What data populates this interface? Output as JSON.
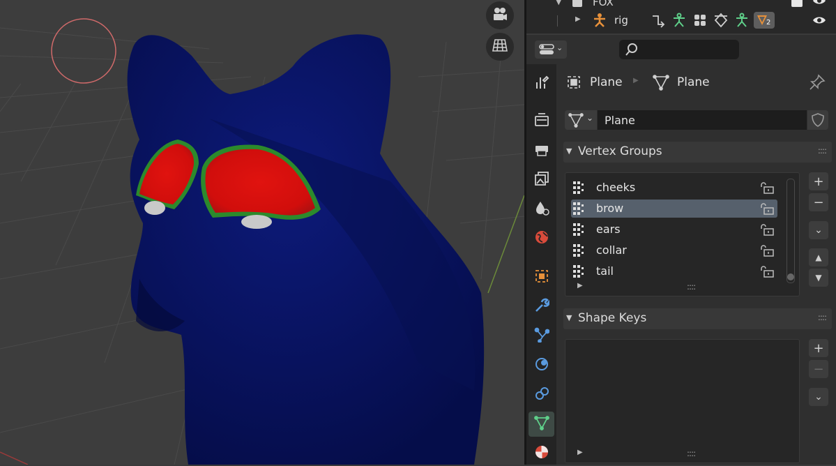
{
  "outliner": {
    "collection_name": "FOX",
    "rig_name": "rig",
    "modifier_badge_count": "2"
  },
  "properties": {
    "search": {
      "placeholder": ""
    },
    "breadcrumb": {
      "object_name": "Plane",
      "data_name": "Plane"
    },
    "mesh_name": "Plane",
    "vertex_groups": {
      "title": "Vertex Groups",
      "items": [
        {
          "label": "cheeks",
          "selected": false
        },
        {
          "label": "brow",
          "selected": true
        },
        {
          "label": "ears",
          "selected": false
        },
        {
          "label": "collar",
          "selected": false
        },
        {
          "label": "tail",
          "selected": false
        }
      ]
    },
    "shape_keys": {
      "title": "Shape Keys"
    },
    "tabs": [
      "tool",
      "render",
      "output",
      "view-layer",
      "scene",
      "world",
      "object",
      "modifiers",
      "particles",
      "physics",
      "constraints",
      "data",
      "material"
    ],
    "active_tab": "data"
  },
  "colors": {
    "weight_zero": "#0a1670",
    "weight_full": "#dd0a0a",
    "selection": "#56606c",
    "active_tab_icon": "#5fd08a"
  }
}
